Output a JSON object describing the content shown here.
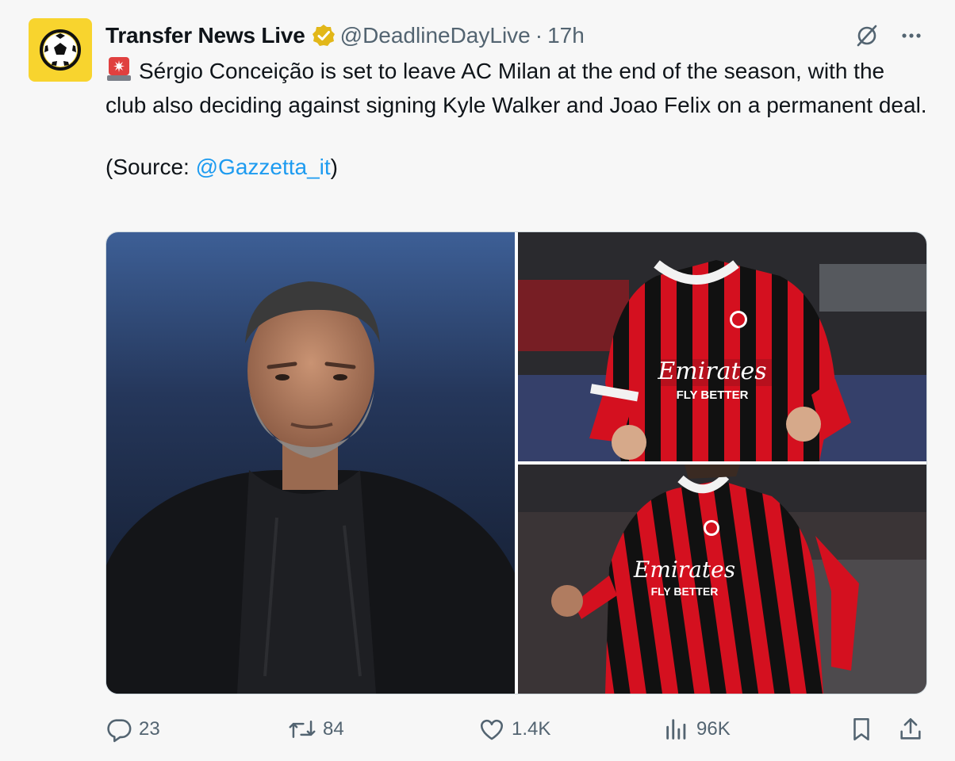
{
  "tweet": {
    "author": {
      "name": "Transfer News Live",
      "handle": "@DeadlineDayLive",
      "separator": "·",
      "time": "17h"
    },
    "text": {
      "main": "Sérgio Conceição is set to leave AC Milan at the end of the season, with the club also deciding against signing Kyle Walker and Joao Felix on a permanent deal.",
      "source_prefix": "(Source: ",
      "source_mention": "@Gazzetta_it",
      "source_suffix": ")"
    },
    "media": {
      "jersey_sponsor": "Emirates",
      "jersey_slogan": "FLY BETTER"
    },
    "metrics": {
      "replies": "23",
      "reposts": "84",
      "likes": "1.4K",
      "views": "96K"
    }
  },
  "icons": {
    "avatar": "soccer-ball-icon",
    "verified": "verified-badge-icon",
    "grok": "grok-icon",
    "more": "more-icon",
    "siren": "siren-emoji-icon",
    "reply": "reply-icon",
    "repost": "repost-icon",
    "like": "like-icon",
    "views": "views-icon",
    "bookmark": "bookmark-icon",
    "share": "share-icon"
  },
  "colors": {
    "link": "#1d9bf0",
    "secondary_text": "#536471",
    "verified_gold": "#e2b719",
    "avatar_bg": "#f8d42e",
    "milan_red": "#d4101f"
  }
}
